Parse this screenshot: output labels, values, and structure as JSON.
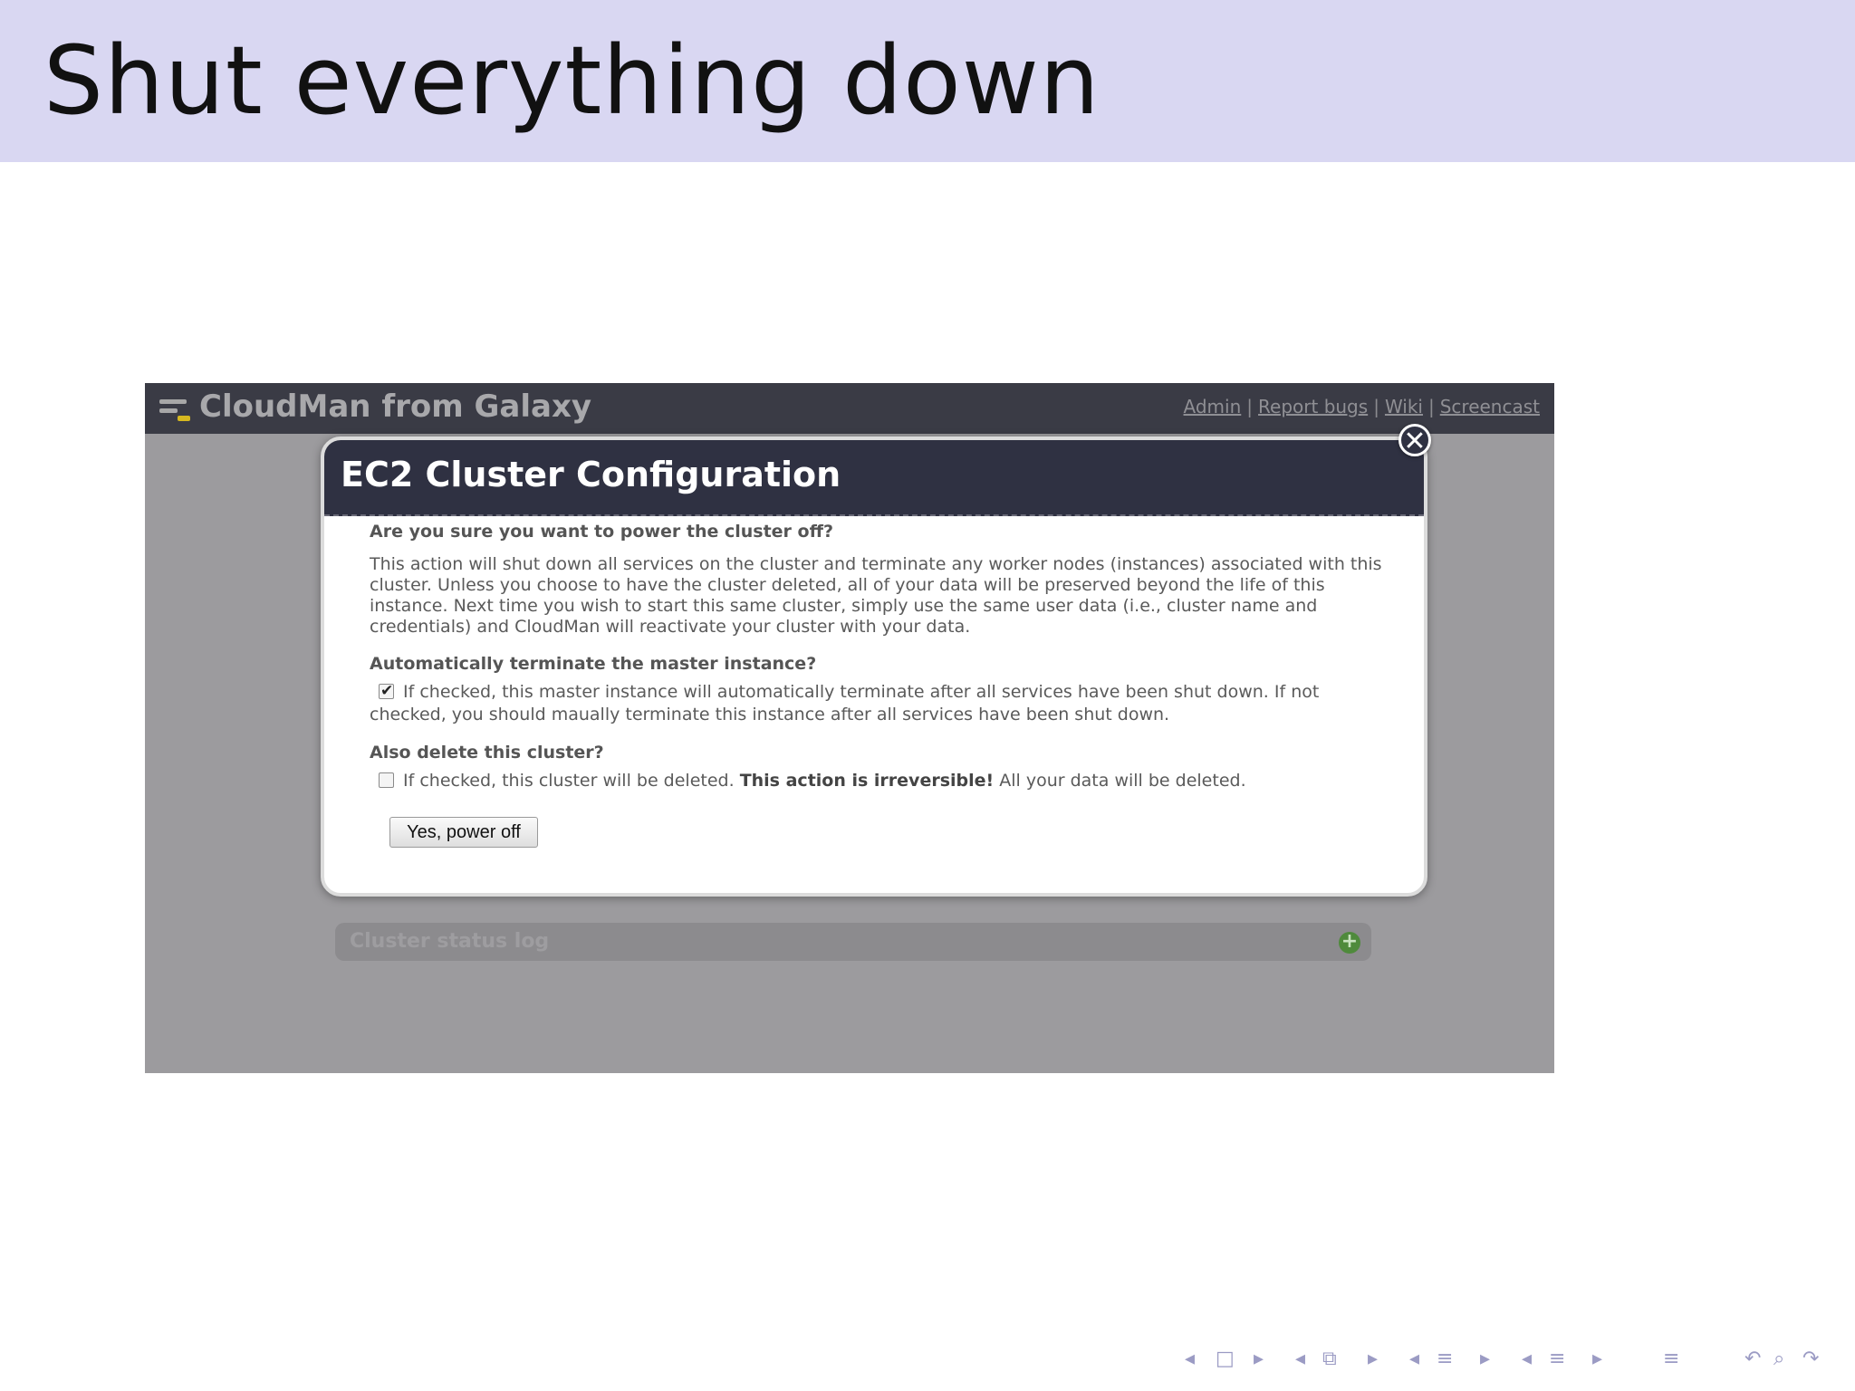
{
  "slide": {
    "title": "Shut everything down"
  },
  "app": {
    "title": "CloudMan from Galaxy",
    "links": [
      "Admin",
      "Report bugs",
      "Wiki",
      "Screencast"
    ],
    "link_separator": "|"
  },
  "dialog": {
    "title": "EC2 Cluster Configuration",
    "question": "Are you sure you want to power the cluster off?",
    "description": "This action will shut down all services on the cluster and terminate any worker nodes (instances) associated with this cluster. Unless you choose to have the cluster deleted, all of your data will be preserved beyond the life of this instance. Next time you wish to start this same cluster, simply use the same user data (i.e., cluster name and credentials) and CloudMan will reactivate your cluster with your data.",
    "terminate_heading": "Automatically terminate the master instance?",
    "terminate_checked": true,
    "terminate_text": "If checked, this master instance will automatically terminate after all services have been shut down. If not checked, you should maually terminate this instance after all services have been shut down.",
    "delete_heading": "Also delete this cluster?",
    "delete_checked": false,
    "delete_text_before": "If checked, this cluster will be deleted.",
    "delete_text_warning": "This action is irreversible!",
    "delete_text_after": "All your data will be deleted.",
    "confirm_button": "Yes, power off",
    "close_symbol": "✕"
  },
  "status_log": {
    "label": "Cluster status log",
    "expand_symbol": "+"
  },
  "nav_icons": [
    "◂",
    "□",
    "▸",
    "◂",
    "⧉",
    "▸",
    "◂",
    "≡",
    "▸",
    "◂",
    "≡",
    "▸",
    "≡",
    "↶",
    "⌕",
    "↷"
  ],
  "colors": {
    "slide_header_bg": "#d9d7f2",
    "app_bar_bg": "#3a3b45",
    "dialog_header_bg": "#2f3142",
    "overlay_bg": "#9c9b9e"
  }
}
